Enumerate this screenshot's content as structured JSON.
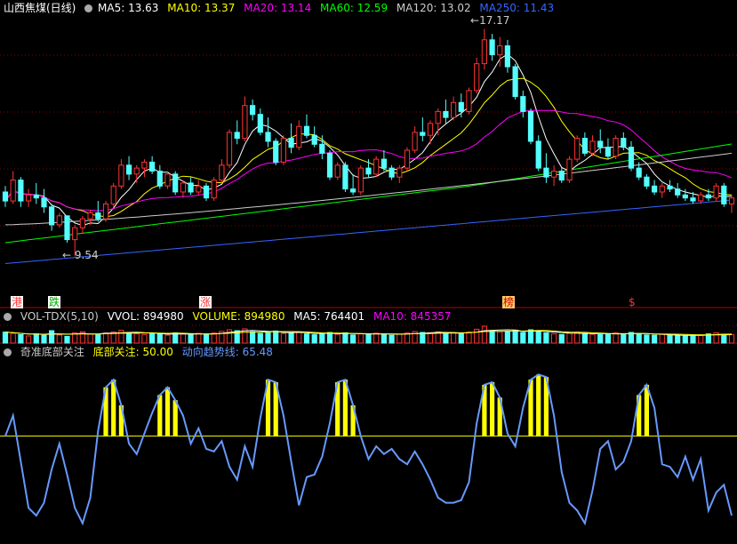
{
  "main": {
    "title": "山西焦煤(日线)",
    "ma": [
      {
        "label": "MA5: 13.63",
        "color": "#ffffff"
      },
      {
        "label": "MA10: 13.37",
        "color": "#ffff00"
      },
      {
        "label": "MA20: 13.14",
        "color": "#ff00ff"
      },
      {
        "label": "MA60: 12.59",
        "color": "#00ff00"
      },
      {
        "label": "MA120: 13.02",
        "color": "#cccccc"
      },
      {
        "label": "MA250: 11.43",
        "color": "#3366ff"
      }
    ],
    "high_label": "17.17",
    "low_label": "9.54",
    "events": [
      {
        "text": "港",
        "color": "#ff3333",
        "bg": "#ffffff"
      },
      {
        "text": "跌",
        "color": "#00aa00",
        "bg": "#ffffff"
      },
      {
        "text": "涨",
        "color": "#ff3333",
        "bg": "#ffffff"
      },
      {
        "text": "榜",
        "color": "#cc0000",
        "bg": "#ffcc66"
      },
      {
        "text": "$",
        "color": "#ff3333",
        "bg": ""
      }
    ]
  },
  "volume": {
    "title": "VOL-TDX(5,10)",
    "items": [
      {
        "label": "VVOL: 894980",
        "color": "#ffffff"
      },
      {
        "label": "VOLUME: 894980",
        "color": "#ffff00"
      },
      {
        "label": "MA5: 764401",
        "color": "#ffffff"
      },
      {
        "label": "MA10: 845357",
        "color": "#ff00ff"
      }
    ]
  },
  "indicator": {
    "title": "奇准底部关注",
    "items": [
      {
        "label": "底部关注: 50.00",
        "color": "#ffff00"
      },
      {
        "label": "动向趋势线: 65.48",
        "color": "#6699ff"
      }
    ]
  },
  "colors": {
    "up": "#ff3333",
    "down": "#54ffff",
    "bg": "#000000",
    "grid": "#880000"
  },
  "chart_data": [
    {
      "type": "candlestick",
      "title": "山西焦煤(日线)",
      "y_reference": {
        "high": 17.17,
        "low": 9.54
      },
      "ohlc": [
        [
          11.7,
          11.9,
          11.2,
          11.4
        ],
        [
          11.4,
          12.4,
          11.3,
          12.1
        ],
        [
          12.1,
          12.2,
          11.2,
          11.4
        ],
        [
          11.4,
          11.8,
          11.2,
          11.6
        ],
        [
          11.6,
          12.0,
          11.3,
          11.5
        ],
        [
          11.5,
          11.8,
          11.0,
          11.2
        ],
        [
          11.2,
          11.3,
          10.4,
          10.6
        ],
        [
          10.6,
          11.0,
          10.5,
          10.9
        ],
        [
          10.9,
          10.9,
          10.0,
          10.1
        ],
        [
          10.1,
          10.6,
          9.54,
          10.5
        ],
        [
          10.5,
          10.9,
          10.3,
          10.8
        ],
        [
          10.8,
          11.1,
          10.6,
          11.0
        ],
        [
          11.0,
          11.4,
          10.7,
          10.8
        ],
        [
          10.8,
          11.4,
          10.7,
          11.3
        ],
        [
          11.3,
          12.0,
          11.2,
          11.9
        ],
        [
          11.9,
          12.8,
          11.8,
          12.6
        ],
        [
          12.6,
          12.9,
          12.1,
          12.3
        ],
        [
          12.3,
          12.6,
          12.0,
          12.5
        ],
        [
          12.5,
          12.8,
          12.2,
          12.7
        ],
        [
          12.7,
          12.9,
          12.3,
          12.4
        ],
        [
          12.4,
          12.6,
          11.8,
          11.9
        ],
        [
          11.9,
          12.4,
          11.8,
          12.3
        ],
        [
          12.3,
          12.4,
          11.6,
          11.7
        ],
        [
          11.7,
          12.1,
          11.5,
          12.0
        ],
        [
          12.0,
          12.2,
          11.6,
          11.7
        ],
        [
          11.7,
          12.1,
          11.6,
          11.9
        ],
        [
          11.9,
          12.0,
          11.4,
          11.5
        ],
        [
          11.5,
          12.2,
          11.4,
          12.1
        ],
        [
          12.1,
          12.8,
          12.0,
          12.6
        ],
        [
          12.6,
          13.8,
          12.5,
          13.7
        ],
        [
          13.7,
          14.1,
          13.3,
          13.5
        ],
        [
          13.5,
          14.9,
          13.4,
          14.6
        ],
        [
          14.6,
          14.8,
          14.1,
          14.3
        ],
        [
          14.3,
          14.5,
          13.6,
          13.7
        ],
        [
          13.7,
          14.2,
          13.2,
          13.4
        ],
        [
          13.4,
          13.5,
          12.6,
          12.7
        ],
        [
          12.7,
          13.6,
          12.6,
          13.5
        ],
        [
          13.5,
          14.0,
          13.0,
          13.2
        ],
        [
          13.2,
          14.1,
          13.1,
          13.9
        ],
        [
          13.9,
          14.3,
          13.5,
          13.6
        ],
        [
          13.6,
          13.9,
          13.2,
          13.3
        ],
        [
          13.3,
          13.6,
          12.8,
          13.0
        ],
        [
          13.0,
          13.1,
          12.1,
          12.2
        ],
        [
          12.2,
          12.7,
          12.1,
          12.6
        ],
        [
          12.6,
          12.7,
          11.7,
          11.8
        ],
        [
          11.8,
          12.3,
          11.6,
          11.7
        ],
        [
          11.7,
          12.6,
          11.6,
          12.5
        ],
        [
          12.5,
          12.8,
          12.2,
          12.3
        ],
        [
          12.3,
          12.9,
          12.2,
          12.8
        ],
        [
          12.8,
          13.1,
          12.4,
          12.5
        ],
        [
          12.5,
          12.6,
          12.1,
          12.2
        ],
        [
          12.2,
          12.6,
          12.0,
          12.5
        ],
        [
          12.5,
          13.2,
          12.4,
          13.1
        ],
        [
          13.1,
          13.9,
          13.0,
          13.7
        ],
        [
          13.7,
          14.2,
          13.4,
          13.6
        ],
        [
          13.6,
          14.1,
          13.3,
          14.0
        ],
        [
          14.0,
          14.5,
          13.6,
          14.4
        ],
        [
          14.4,
          14.8,
          14.0,
          14.2
        ],
        [
          14.2,
          14.9,
          14.1,
          14.7
        ],
        [
          14.7,
          15.0,
          14.2,
          14.4
        ],
        [
          14.4,
          15.2,
          14.3,
          15.1
        ],
        [
          15.1,
          16.2,
          15.0,
          16.0
        ],
        [
          16.0,
          17.17,
          15.8,
          16.8
        ],
        [
          16.8,
          17.0,
          16.1,
          16.3
        ],
        [
          16.3,
          16.9,
          15.9,
          16.6
        ],
        [
          16.6,
          16.8,
          15.7,
          15.9
        ],
        [
          15.9,
          16.0,
          14.8,
          14.9
        ],
        [
          14.9,
          15.1,
          14.2,
          14.4
        ],
        [
          14.4,
          14.5,
          13.3,
          13.4
        ],
        [
          13.4,
          13.6,
          12.4,
          12.5
        ],
        [
          12.5,
          13.0,
          12.0,
          12.2
        ],
        [
          12.2,
          12.6,
          11.9,
          12.4
        ],
        [
          12.4,
          12.5,
          12.0,
          12.1
        ],
        [
          12.1,
          12.9,
          12.0,
          12.8
        ],
        [
          12.8,
          13.6,
          12.7,
          13.5
        ],
        [
          13.5,
          13.7,
          12.9,
          13.0
        ],
        [
          13.0,
          13.6,
          12.9,
          13.4
        ],
        [
          13.4,
          13.8,
          13.0,
          13.2
        ],
        [
          13.2,
          13.5,
          12.8,
          12.9
        ],
        [
          12.9,
          13.6,
          12.8,
          13.5
        ],
        [
          13.5,
          13.7,
          13.1,
          13.2
        ],
        [
          13.2,
          13.4,
          12.4,
          12.5
        ],
        [
          12.5,
          12.7,
          12.1,
          12.2
        ],
        [
          12.2,
          12.3,
          11.8,
          11.9
        ],
        [
          11.9,
          12.1,
          11.6,
          11.7
        ],
        [
          11.7,
          12.0,
          11.5,
          11.9
        ],
        [
          11.9,
          12.1,
          11.7,
          11.8
        ],
        [
          11.8,
          12.0,
          11.5,
          11.6
        ],
        [
          11.6,
          11.8,
          11.4,
          11.5
        ],
        [
          11.5,
          11.7,
          11.3,
          11.4
        ],
        [
          11.4,
          11.7,
          11.3,
          11.6
        ],
        [
          11.6,
          11.8,
          11.4,
          11.5
        ],
        [
          11.5,
          12.0,
          11.4,
          11.9
        ],
        [
          11.9,
          12.0,
          11.2,
          11.3
        ],
        [
          11.3,
          11.6,
          11.0,
          11.5
        ]
      ]
    },
    {
      "type": "bar",
      "title": "VOL-TDX(5,10)",
      "values": [
        62,
        55,
        48,
        40,
        52,
        44,
        70,
        46,
        38,
        58,
        64,
        52,
        47,
        57,
        63,
        72,
        60,
        53,
        48,
        56,
        50,
        45,
        58,
        52,
        47,
        55,
        49,
        57,
        66,
        75,
        70,
        80,
        64,
        55,
        60,
        68,
        54,
        58,
        62,
        52,
        47,
        55,
        60,
        50,
        58,
        46,
        52,
        49,
        56,
        51,
        44,
        50,
        57,
        65,
        60,
        58,
        63,
        55,
        60,
        54,
        62,
        78,
        95,
        70,
        64,
        67,
        72,
        60,
        75,
        66,
        58,
        52,
        49,
        56,
        62,
        54,
        50,
        48,
        51,
        57,
        53,
        60,
        52,
        46,
        44,
        49,
        45,
        42,
        40,
        46,
        44,
        52,
        58,
        50,
        48
      ]
    },
    {
      "type": "line",
      "title": "奇准底部关注",
      "threshold": 50,
      "series": [
        {
          "name": "动向趋势线",
          "values": [
            50,
            58,
            40,
            22,
            19,
            24,
            37,
            47,
            35,
            22,
            16,
            26,
            52,
            69,
            72,
            62,
            47,
            43,
            51,
            59,
            66,
            69,
            64,
            58,
            47,
            53,
            45,
            44,
            48,
            38,
            33,
            46,
            38,
            57,
            72,
            71,
            58,
            40,
            23,
            34,
            35,
            42,
            55,
            71,
            72,
            62,
            50,
            41,
            46,
            43,
            45,
            41,
            39,
            44,
            39,
            33,
            26,
            24,
            24,
            25,
            32,
            55,
            70,
            71,
            65,
            51,
            46,
            61,
            72,
            74,
            73,
            58,
            36,
            24,
            21,
            16,
            29,
            45,
            48,
            37,
            40,
            48,
            66,
            70,
            61,
            39,
            38,
            34,
            42,
            33,
            41,
            21,
            28,
            31,
            19
          ]
        }
      ]
    }
  ]
}
